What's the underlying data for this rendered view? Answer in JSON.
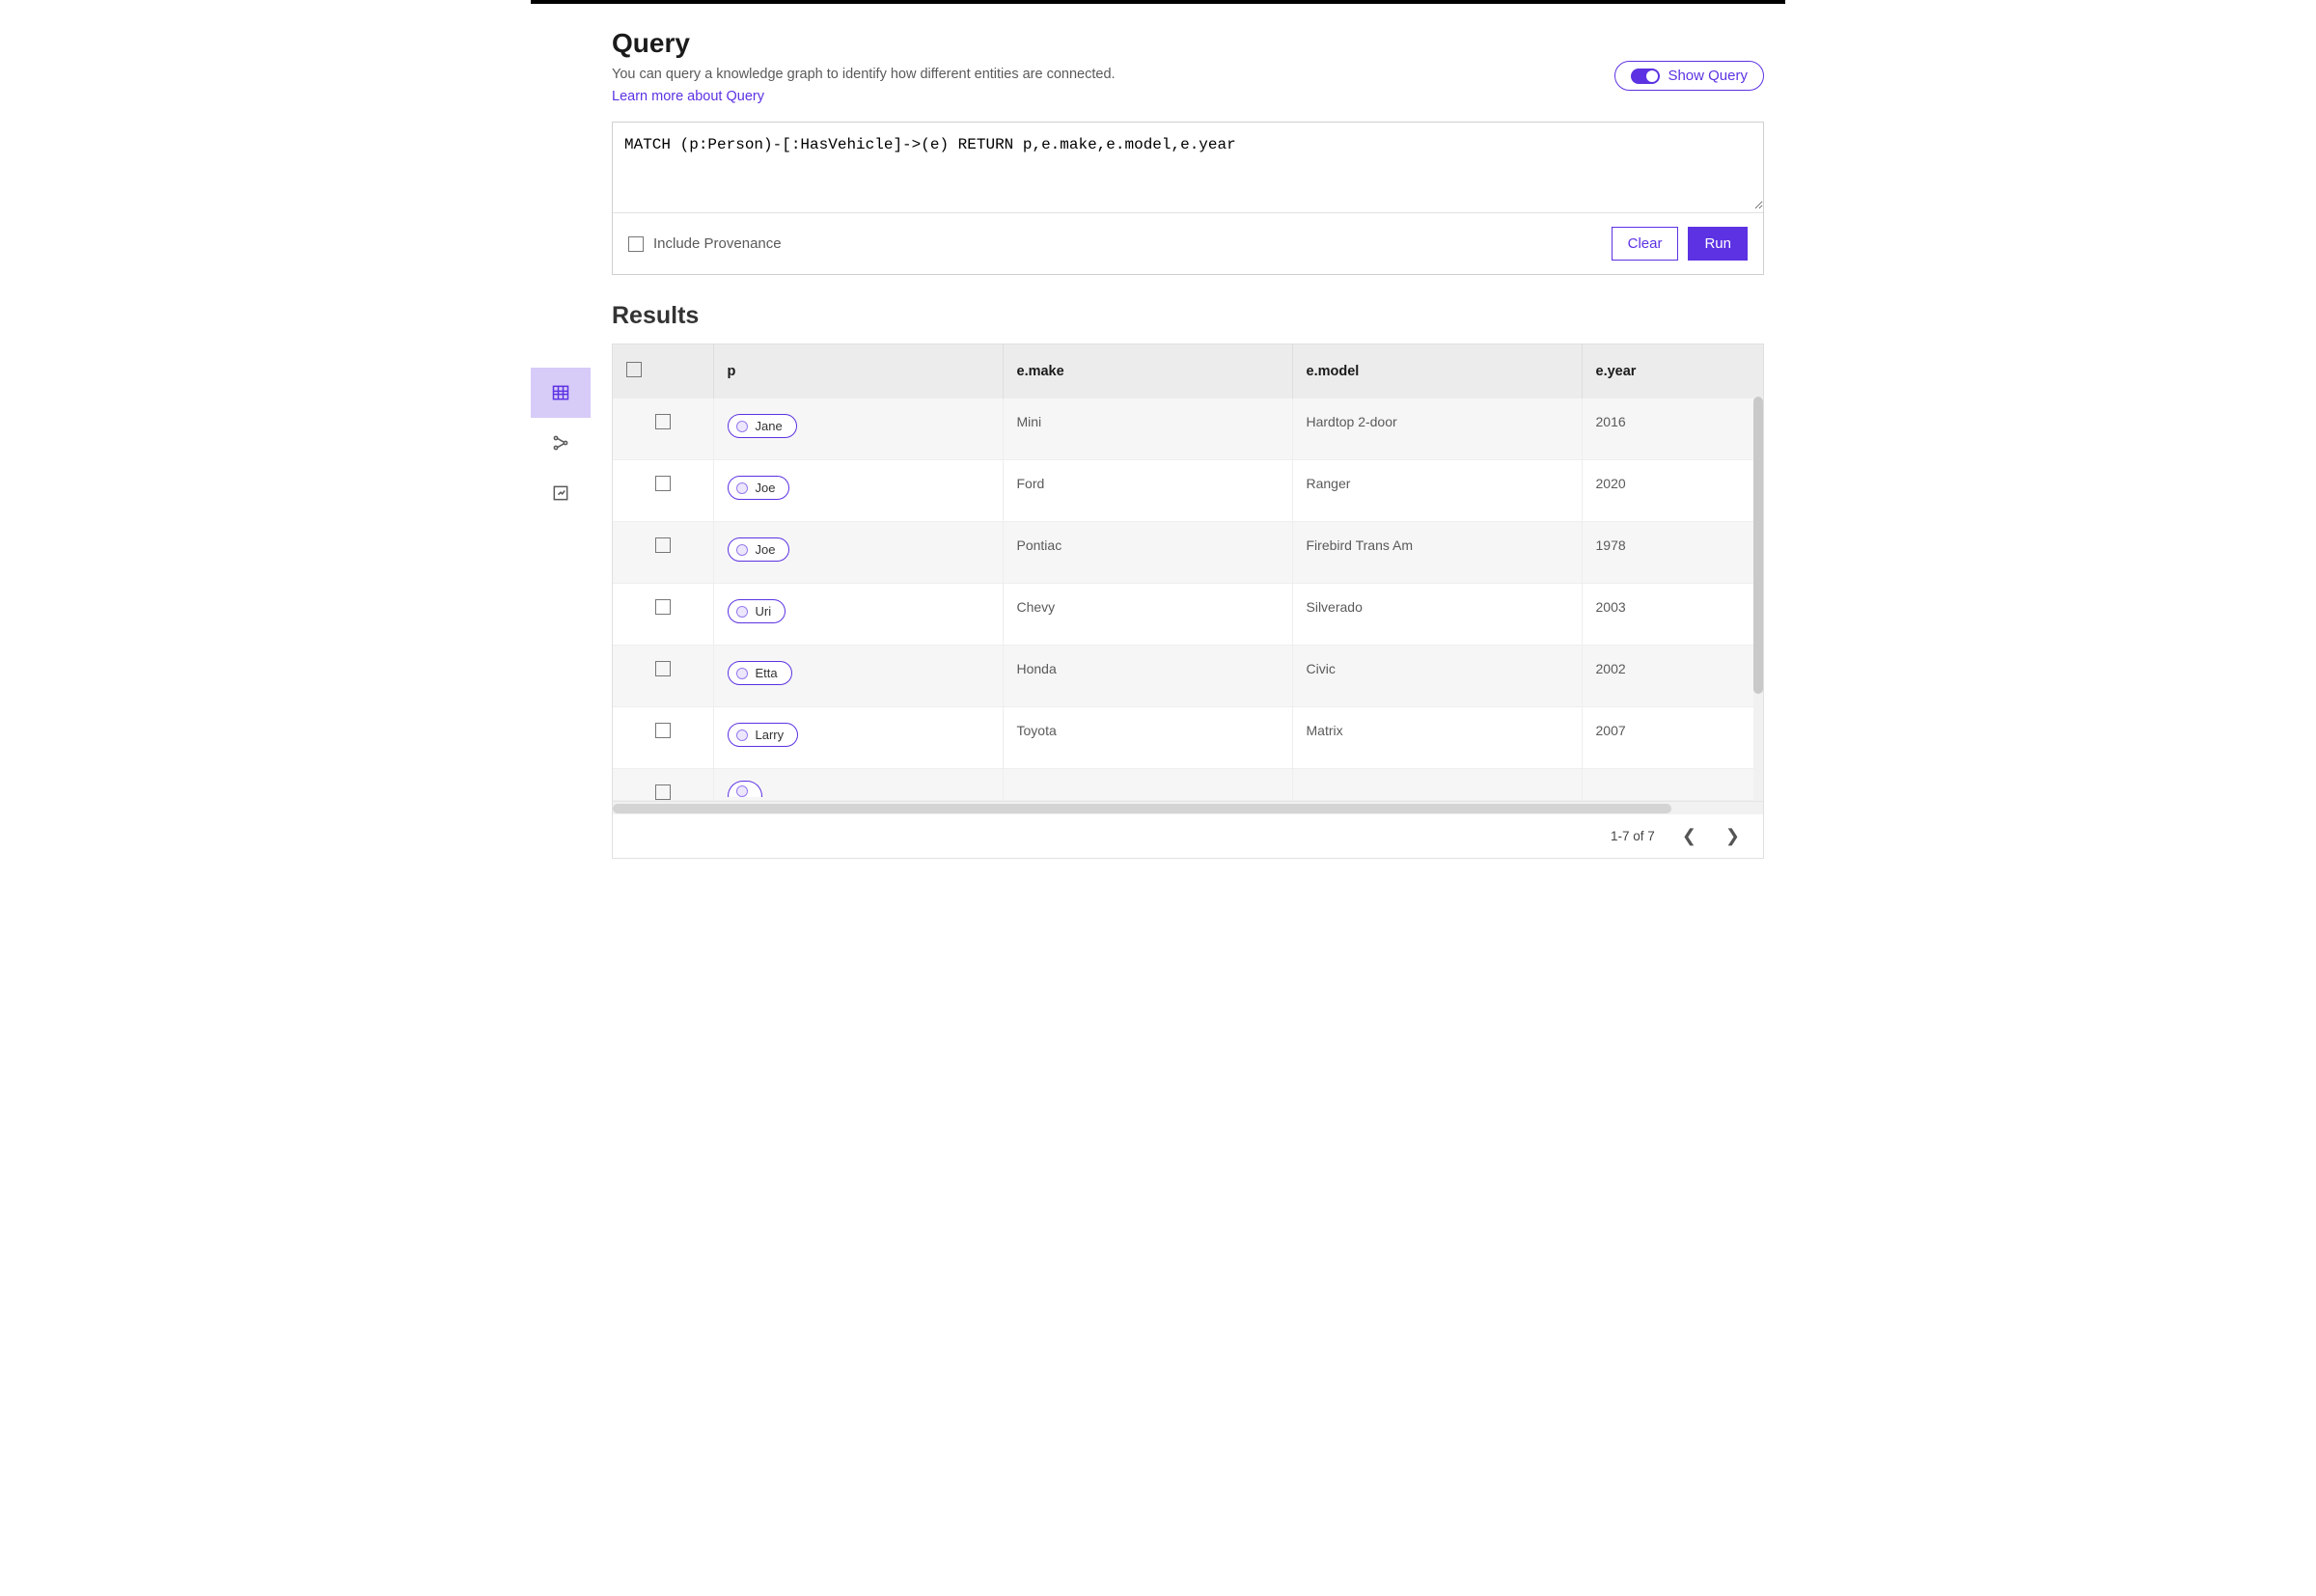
{
  "header": {
    "title": "Query",
    "subtitle": "You can query a knowledge graph to identify how different entities are connected.",
    "learn_more": "Learn more about Query",
    "show_query_label": "Show Query"
  },
  "query": {
    "text": "MATCH (p:Person)-[:HasVehicle]->(e) RETURN p,e.make,e.model,e.year",
    "include_provenance_label": "Include Provenance",
    "clear_label": "Clear",
    "run_label": "Run"
  },
  "results": {
    "heading": "Results",
    "columns": {
      "p": "p",
      "make": "e.make",
      "model": "e.model",
      "year": "e.year"
    },
    "rows": [
      {
        "p": "Jane",
        "make": "Mini",
        "model": "Hardtop 2-door",
        "year": "2016"
      },
      {
        "p": "Joe",
        "make": "Ford",
        "model": "Ranger",
        "year": "2020"
      },
      {
        "p": "Joe",
        "make": "Pontiac",
        "model": "Firebird Trans Am",
        "year": "1978"
      },
      {
        "p": "Uri",
        "make": "Chevy",
        "model": "Silverado",
        "year": "2003"
      },
      {
        "p": "Etta",
        "make": "Honda",
        "model": "Civic",
        "year": "2002"
      },
      {
        "p": "Larry",
        "make": "Toyota",
        "model": "Matrix",
        "year": "2007"
      }
    ],
    "pager": "1-7 of 7"
  }
}
